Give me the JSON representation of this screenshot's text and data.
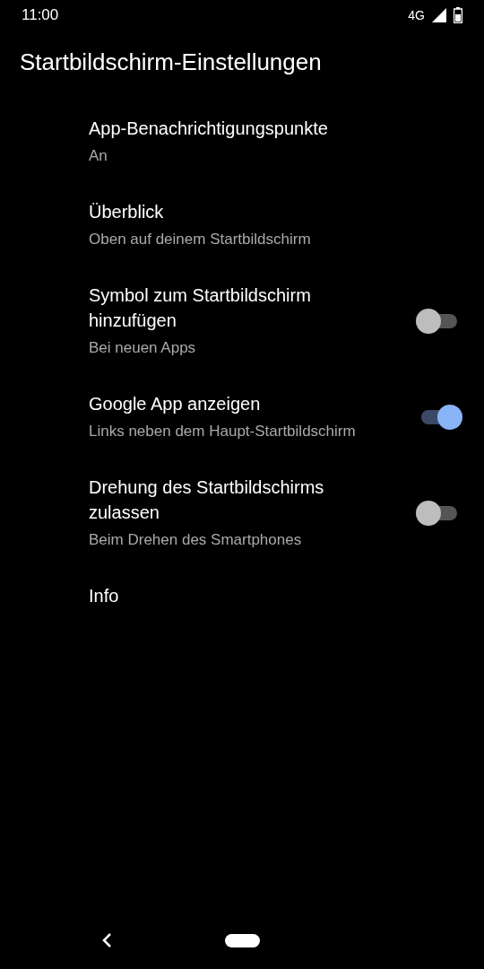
{
  "status_bar": {
    "time": "11:00",
    "network": "4G"
  },
  "title": "Startbildschirm-Einstellungen",
  "settings": [
    {
      "kind": "plain",
      "title": "App-Benachrichtigungspunkte",
      "summary": "An"
    },
    {
      "kind": "plain",
      "title": "Überblick",
      "summary": "Oben auf deinem Startbildschirm"
    },
    {
      "kind": "switch",
      "title": "Symbol zum Startbildschirm hinzufügen",
      "summary": "Bei neuen Apps",
      "on": false
    },
    {
      "kind": "switch",
      "title": "Google App anzeigen",
      "summary": "Links neben dem Haupt-Startbildschirm",
      "on": true
    },
    {
      "kind": "switch",
      "title": "Drehung des Startbildschirms zulassen",
      "summary": "Beim Drehen des Smartphones",
      "on": false
    },
    {
      "kind": "plain",
      "title": "Info"
    }
  ]
}
